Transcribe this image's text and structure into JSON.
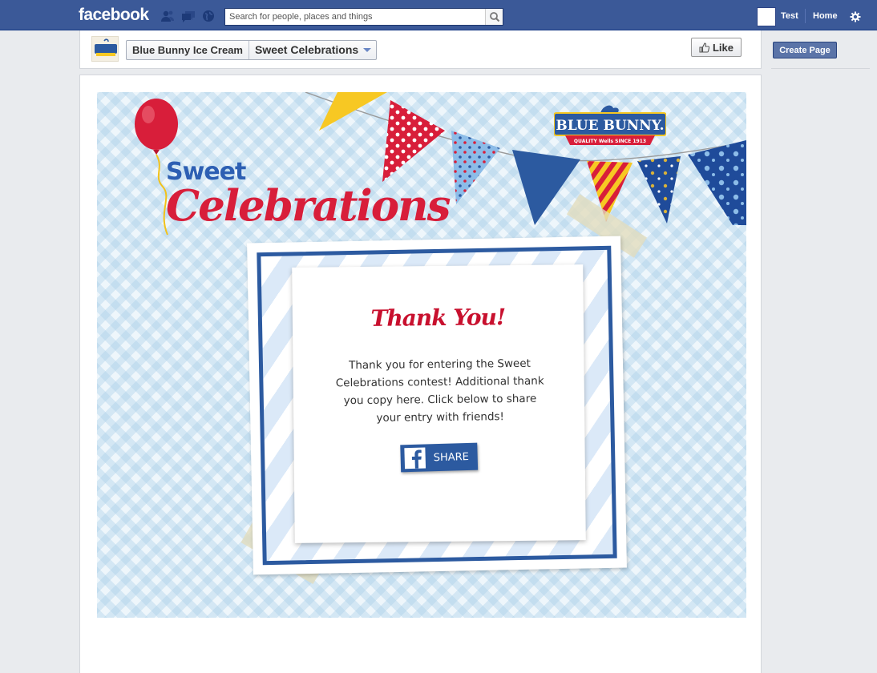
{
  "topbar": {
    "logo": "facebook",
    "search_placeholder": "Search for people, places and things",
    "user_name": "Test",
    "home_label": "Home"
  },
  "page_header": {
    "page_name": "Blue Bunny Ice Cream",
    "app_name": "Sweet Celebrations",
    "like_label": "Like",
    "thumb_text": "BLUE BUNNY"
  },
  "sidebar": {
    "create_page_label": "Create Page"
  },
  "app": {
    "brand": "BLUE BUNNY.",
    "brand_tagline": "QUALITY Wells SINCE 1913",
    "title_line1": "Sweet",
    "title_line2": "Celebrations",
    "thank_you_heading": "Thank You!",
    "thank_you_body": "Thank you for entering the Sweet Celebrations contest! Additional thank you copy here. Click below to share your entry with friends!",
    "share_label": "SHARE"
  },
  "colors": {
    "facebook_blue": "#3b5998",
    "brand_blue": "#2c5aa0",
    "brand_red": "#d81e3a",
    "banner_yellow": "#f7c823"
  }
}
